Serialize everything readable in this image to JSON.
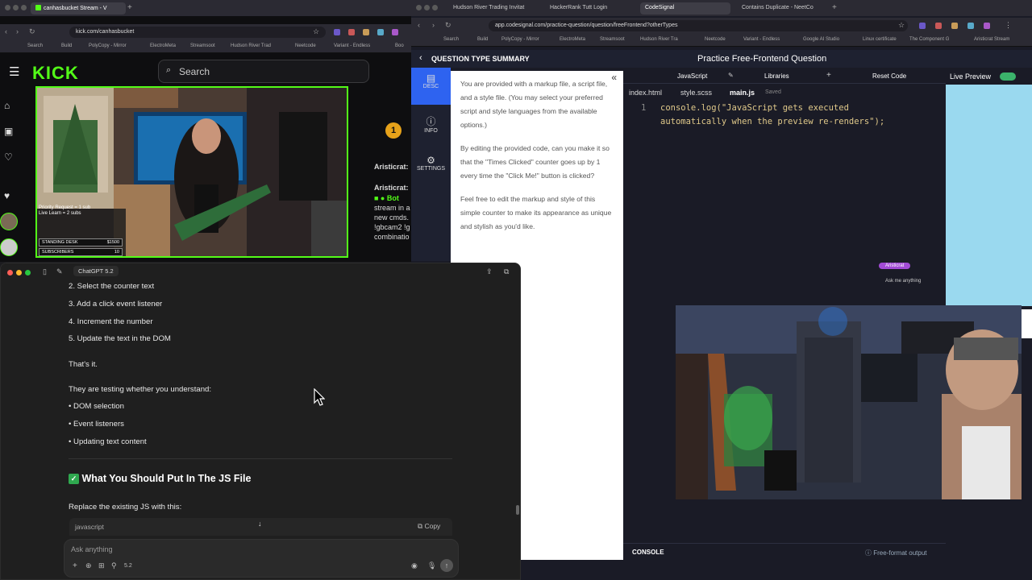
{
  "left_browser": {
    "tabs": [
      {
        "title": "canhasbucket Stream - V",
        "active": true
      }
    ],
    "url": "kick.com/canhasbucket",
    "bookmarks": [
      "Search",
      "Build",
      "PolyCopy - Mirror",
      "ElectroMeta",
      "Streamsoot",
      "Hudson River Trad",
      "Neetcode",
      "Variant - Endless",
      "Boo"
    ],
    "kick": {
      "logo": "KICK",
      "search_placeholder": "Search",
      "overlay": {
        "line1": "Priority Request = 1 sub",
        "line2": "Live Learn = 2 subs",
        "standing_desk": "STANDING DESK",
        "standing_desk_amount": "$1500",
        "subscribers": "SUBSCRIBERS",
        "subscribers_count": "10"
      },
      "chat_lines": [
        "Aristicrat:",
        "Aristicrat:",
        "Bot",
        "stream in a",
        "new cmds.",
        "!gbcam2 !g",
        "combinatio"
      ],
      "chat_badge": "1"
    }
  },
  "right_browser": {
    "tabs": [
      {
        "title": "Hudson River Trading Invitat",
        "active": false
      },
      {
        "title": "HackerRank Tutt Login",
        "active": false
      },
      {
        "title": "CodeSignal",
        "active": true
      },
      {
        "title": "Contains Duplicate - NeetCo",
        "active": false
      }
    ],
    "url": "app.codesignal.com/practice-question/question/freeFrontend?otherTypes",
    "bookmarks": [
      "Search",
      "Build",
      "PolyCopy - Mirror",
      "ElectroMeta",
      "Streamsoot",
      "Hudson River Tra",
      "Neetcode",
      "Variant - Endless",
      "Google AI Studio",
      "Linux certificate",
      "The Component G",
      "Aristicrat Stream"
    ],
    "codesignal": {
      "back_label": "QUESTION TYPE SUMMARY",
      "page_title": "Practice Free-Frontend Question",
      "language": "JavaScript",
      "libraries": "Libraries",
      "reset": "Reset Code",
      "live_preview": "Live Preview",
      "files": [
        "index.html",
        "style.scss",
        "main.js"
      ],
      "saved": "Saved",
      "sidebar": [
        {
          "label": "DESC",
          "icon": "document-icon"
        },
        {
          "label": "INFO",
          "icon": "info-icon"
        },
        {
          "label": "SETTINGS",
          "icon": "gear-icon"
        }
      ],
      "description": [
        "You are provided with a markup file, a script file, and a style file. (You may select your preferred script and style languages from the available options.)",
        "By editing the provided code, can you make it so that the \"Times Clicked\" counter goes up by 1 every time the \"Click Me!\" button is clicked?",
        "Feel free to edit the markup and style of this simple counter to make its appearance as unique and stylish as you'd like."
      ],
      "code_line_number": "1",
      "code_line_1": "console.log(\"JavaScript gets executed",
      "code_line_2": "automatically when the preview re-renders\");",
      "console_label": "CONSOLE",
      "free_format": "Free-format output",
      "preview_chip": "Aristicrat",
      "preview_ask": "Ask me anything"
    }
  },
  "chatgpt": {
    "title": "ChatGPT 5.2",
    "steps": [
      "2.  Select the counter text",
      "3.  Add a click event listener",
      "4.  Increment the number",
      "5.  Update the text in the DOM"
    ],
    "thats_it": "That's it.",
    "testing_intro": "They are testing whether you understand:",
    "bullets": [
      "• DOM selection",
      "• Event listeners",
      "• Updating text content"
    ],
    "heading": "What You Should Put In The JS File",
    "replace_text": "Replace the existing JS with this:",
    "code_lang": "javascript",
    "copy": "Copy",
    "composer_placeholder": "Ask anything",
    "model_badge": "5.2"
  }
}
